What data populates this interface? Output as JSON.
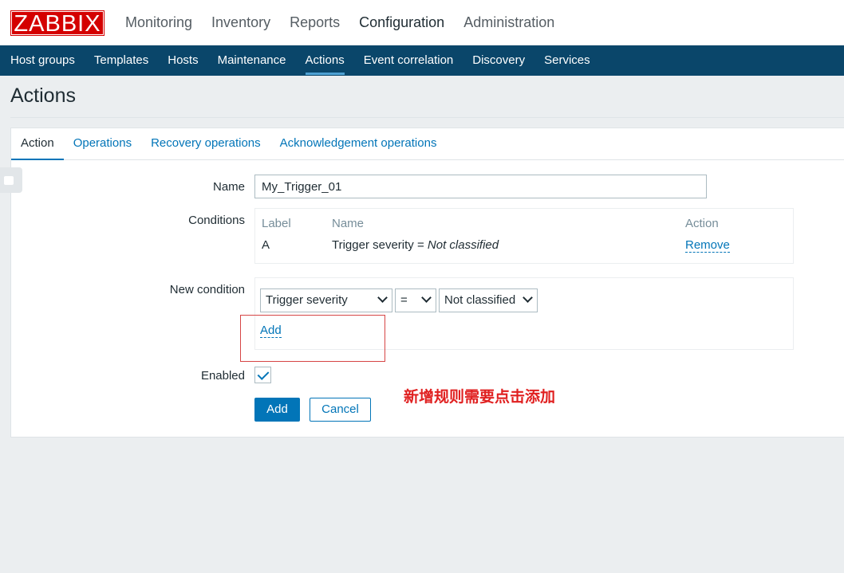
{
  "logo": "ZABBIX",
  "main_nav": [
    "Monitoring",
    "Inventory",
    "Reports",
    "Configuration",
    "Administration"
  ],
  "main_nav_selected": "Configuration",
  "sub_nav": [
    "Host groups",
    "Templates",
    "Hosts",
    "Maintenance",
    "Actions",
    "Event correlation",
    "Discovery",
    "Services"
  ],
  "sub_nav_selected": "Actions",
  "page_title": "Actions",
  "tabs": [
    "Action",
    "Operations",
    "Recovery operations",
    "Acknowledgement operations"
  ],
  "active_tab": "Action",
  "form": {
    "name_label": "Name",
    "name_value": "My_Trigger_01",
    "conditions_label": "Conditions",
    "conditions_headers": {
      "label": "Label",
      "name": "Name",
      "action": "Action"
    },
    "condition_row": {
      "label": "A",
      "name_prefix": "Trigger severity = ",
      "name_value": "Not classified",
      "action": "Remove"
    },
    "new_condition_label": "New condition",
    "new_condition": {
      "type": "Trigger severity",
      "operator": "=",
      "value": "Not classified",
      "add_link": "Add"
    },
    "enabled_label": "Enabled",
    "enabled": true,
    "add_button": "Add",
    "cancel_button": "Cancel"
  },
  "annotation_text": "新增规则需要点击添加",
  "colors": {
    "brand_red": "#d40000",
    "nav_dark": "#0a466a",
    "link_blue": "#0275b8",
    "annotation_red": "#e02020"
  }
}
